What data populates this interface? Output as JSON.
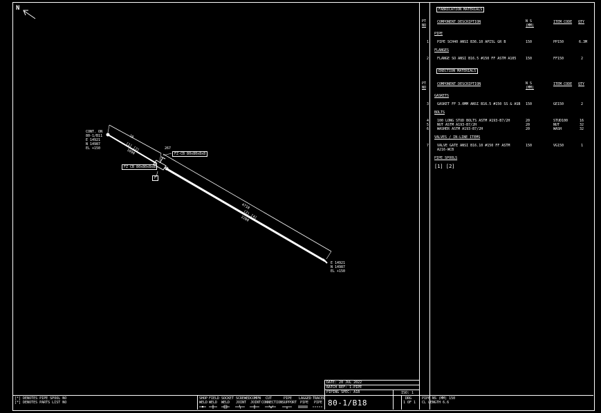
{
  "north": {
    "label": "N"
  },
  "bom": {
    "fabrication_header": "FABRICATION MATERIALS",
    "erection_header": "ERECTION MATERIALS",
    "col_pt": "PT",
    "col_no": "NO",
    "col_desc": "COMPONENT DESCRIPTION",
    "col_ns": "N S",
    "col_ns_unit": "(MM)",
    "col_item": "ITEM CODE",
    "col_qty": "QTY",
    "sec_pipe": "PIPE",
    "sec_flanges": "FLANGES",
    "sec_gaskets": "GASKETS",
    "sec_bolts": "BOLTS",
    "sec_valves": "VALVES / IN-LINE ITEMS",
    "sec_spools": "PIPE SPOOLS",
    "rows": [
      {
        "pt": "1",
        "desc": "PIPE SCH40 ANSI B36.10 API5L GR B",
        "ns": "150",
        "code": "PP150",
        "qty": "6.3M"
      },
      {
        "pt": "2",
        "desc": "FLANGE SO ANSI B16.5 #150 FF ASTM A105",
        "ns": "150",
        "code": "FF150",
        "qty": "2"
      },
      {
        "pt": "3",
        "desc": "GASKET FF 3.0MM ANSI B16.5 #150 SS & ASB",
        "ns": "150",
        "code": "GE150",
        "qty": "2"
      },
      {
        "pt": "4",
        "desc": "100 LONG STUD BOLTS ASTM A193-B7/2H",
        "ns": "20",
        "code": "STUD100",
        "qty": "16"
      },
      {
        "pt": "5",
        "desc": "NUT ASTM A193-B7/2H",
        "ns": "20",
        "code": "NUT",
        "qty": "32"
      },
      {
        "pt": "6",
        "desc": "WASHER ASTM A193-B7/2H",
        "ns": "20",
        "code": "WASH",
        "qty": "32"
      },
      {
        "pt": "7",
        "desc": "VALVE GATE ANSI B16.10 #150 FF ASTM",
        "desc2": "A216-WCB",
        "ns": "150",
        "code": "VG150",
        "qty": "1"
      }
    ],
    "spools": "[1] [2]"
  },
  "drawing": {
    "start_block": [
      "CONT. ON",
      "80-1/B11",
      "E 14921",
      "N 14987",
      "EL +150"
    ],
    "end_block": [
      "E 14921",
      "N 14987",
      "EL +150"
    ],
    "dim_first": "10",
    "dim_first_sub": "[1] [2]",
    "dim_first_num": "1090",
    "dim_main": "4710",
    "dim_main_sub": "(2) [4]",
    "dim_main_num": "2200",
    "angle": "267",
    "flag1": "FZ-CB 80x80x8x8",
    "flag2": "FZ CB 80x80x8x8",
    "tag": "F"
  },
  "title_block": {
    "date": "DATE: 20 JUL 2022",
    "batch": "BATCH REF: 1-PIPE",
    "spec": "PIPING SPEC: A1B",
    "pipe_no": "80-1/B18",
    "iso": "ISO: 1",
    "drg_label": "DRG",
    "drg_value": "1 OF 1",
    "pipe_ns": "PIPE NS (MM)  150",
    "cl_length": "CL LENGTH   6.6"
  },
  "notes": {
    "line1": "[*] DENOTES PIPE SPOOL NO",
    "line2": "[*] DENOTES PARTS LIST NO"
  },
  "legend": [
    {
      "top": "SHOP",
      "bottom": "WELD"
    },
    {
      "top": "FIELD",
      "bottom": "WELD"
    },
    {
      "top": "SOCKET",
      "bottom": "WELD"
    },
    {
      "top": "SCREWED",
      "bottom": "JOINT"
    },
    {
      "top": "COMPN",
      "bottom": "JOINT"
    },
    {
      "top": "CUT",
      "bottom": "CONNECTION"
    },
    {
      "top": "PIPE",
      "bottom": "SUPPORT"
    },
    {
      "top": "LAGGED",
      "bottom": "PIPE"
    },
    {
      "top": "TRACED",
      "bottom": "PIPE"
    }
  ]
}
